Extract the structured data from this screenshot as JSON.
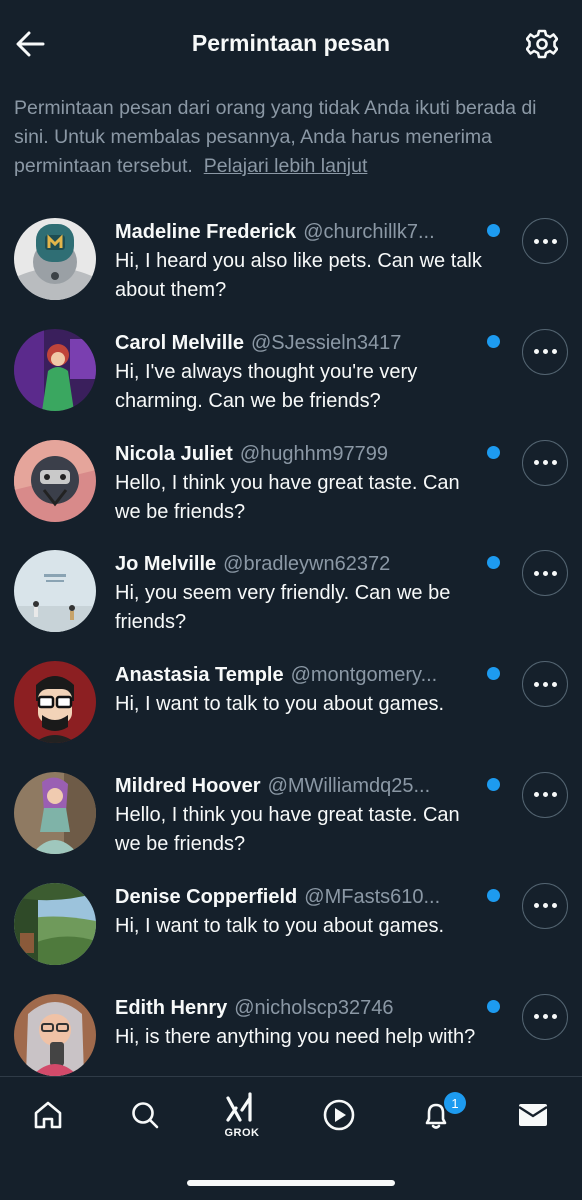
{
  "header": {
    "title": "Permintaan pesan",
    "back_icon": "arrow-left-icon",
    "settings_icon": "gear-icon"
  },
  "intro": {
    "text": "Permintaan pesan dari orang yang tidak Anda ikuti berada di sini. Untuk membalas pesannya, Anda harus menerima permintaan tersebut.",
    "link": "Pelajari lebih lanjut"
  },
  "requests": [
    {
      "name": "Madeline Frederick",
      "handle": "@churchillk7...",
      "message": "Hi, I heard you also like pets. Can we talk about them?",
      "unread": true
    },
    {
      "name": "Carol Melville",
      "handle": "@SJessieln3417",
      "message": "Hi, I've always thought you're very charming. Can we be friends?",
      "unread": true
    },
    {
      "name": "Nicola Juliet",
      "handle": "@hughhm97799",
      "message": "Hello, I think you have great taste. Can we be friends?",
      "unread": true
    },
    {
      "name": "Jo Melville",
      "handle": "@bradleywn62372",
      "message": "Hi, you seem very friendly. Can we be friends?",
      "unread": true
    },
    {
      "name": "Anastasia Temple",
      "handle": "@montgomery...",
      "message": "Hi, I want to talk to you about games.",
      "unread": true
    },
    {
      "name": "Mildred Hoover",
      "handle": "@MWilliamdq25...",
      "message": "Hello, I think you have great taste. Can we be friends?",
      "unread": true
    },
    {
      "name": "Denise Copperfield",
      "handle": "@MFasts610...",
      "message": "Hi, I want to talk to you about games.",
      "unread": true
    },
    {
      "name": "Edith Henry",
      "handle": "@nicholscp32746",
      "message": "Hi, is there anything you need help with?",
      "unread": true
    }
  ],
  "tabbar": {
    "home_icon": "home-icon",
    "search_icon": "search-icon",
    "grok_label": "GROK",
    "video_icon": "play-icon",
    "notifications_icon": "bell-icon",
    "notifications_badge": "1",
    "messages_icon": "envelope-icon"
  },
  "colors": {
    "background": "#15202b",
    "accent": "#1d9bf0",
    "secondary_text": "#8b98a5"
  }
}
